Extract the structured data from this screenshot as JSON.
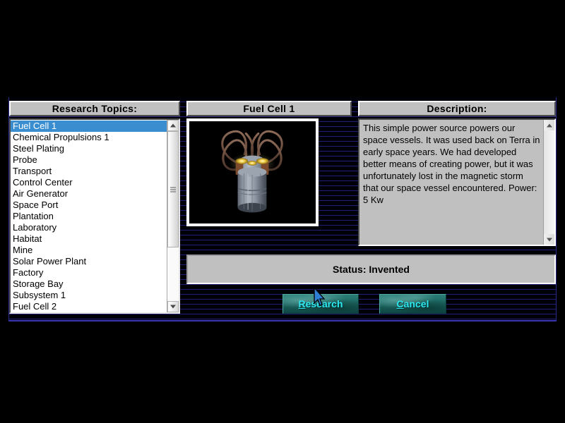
{
  "window": {
    "background_color": "#000000",
    "scanline_color": "#211f74",
    "panel_face_color": "#c0c0c0",
    "accent_color": "#2ee8f0"
  },
  "topics_panel": {
    "caption": "Research Topics:",
    "selected_index": 0,
    "items": [
      {
        "label": "Fuel Cell 1"
      },
      {
        "label": "Chemical Propulsions 1"
      },
      {
        "label": "Steel Plating"
      },
      {
        "label": "Probe"
      },
      {
        "label": "Transport"
      },
      {
        "label": "Control Center"
      },
      {
        "label": "Air Generator"
      },
      {
        "label": "Space Port"
      },
      {
        "label": "Plantation"
      },
      {
        "label": "Laboratory"
      },
      {
        "label": "Habitat"
      },
      {
        "label": "Mine"
      },
      {
        "label": "Solar Power Plant"
      },
      {
        "label": "Factory"
      },
      {
        "label": "Storage Bay"
      },
      {
        "label": "Subsystem 1"
      },
      {
        "label": "Fuel Cell 2"
      }
    ],
    "scrollbar": {
      "up_arrow": "scroll-up-arrow",
      "down_arrow": "scroll-down-arrow",
      "thumb": "scroll-thumb"
    }
  },
  "preview_panel": {
    "caption": "Fuel Cell 1",
    "image_alt": "fuel-cell-render"
  },
  "description_panel": {
    "caption": "Description:",
    "text": "This simple power source powers our space vessels.  It was used back on Terra in early space years. We had developed better means of creating power, but it was unfortunately lost in the magnetic storm that our space vessel encountered.  Power: 5 Kw",
    "scrollbar": {
      "up_arrow": "scroll-up-arrow",
      "down_arrow": "scroll-down-arrow"
    }
  },
  "status": {
    "text": "Status: Invented"
  },
  "buttons": {
    "research": {
      "accel": "R",
      "rest": "esearch"
    },
    "cancel": {
      "accel": "C",
      "rest": "ancel"
    }
  },
  "cursor": {
    "name": "mouse-pointer"
  }
}
